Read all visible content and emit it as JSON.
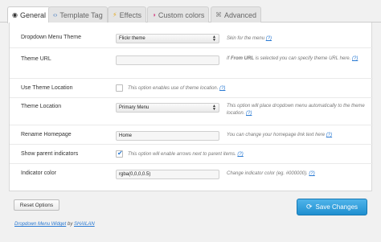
{
  "tabs": [
    {
      "icon": "◉",
      "label": "General"
    },
    {
      "icon": "‹›",
      "label": "Template Tag"
    },
    {
      "icon": "⚡",
      "label": "Effects"
    },
    {
      "icon": "◑",
      "label": "Custom colors"
    },
    {
      "icon": "⌘",
      "label": "Advanced"
    }
  ],
  "rows": {
    "dropdown_theme": {
      "label": "Dropdown Menu Theme",
      "value": "Flickr theme",
      "desc": "Skin for the menu",
      "help": "(?)"
    },
    "theme_url": {
      "label": "Theme URL",
      "value": "",
      "desc_pre": "If ",
      "desc_bold": "From URL",
      "desc_post": " is selected you can specify theme URL here.",
      "help": "(?)"
    },
    "use_location": {
      "label": "Use Theme Location",
      "desc": "This option enables use of theme location.",
      "help": "(?)"
    },
    "theme_location": {
      "label": "Theme Location",
      "value": "Primary Menu",
      "desc": "This option will place dropdown menu automatically to the theme location.",
      "help": "(?)"
    },
    "rename_home": {
      "label": "Rename Homepage",
      "value": "Home",
      "desc": "You can change your homepage link text here",
      "help": "(?)"
    },
    "parent_indicators": {
      "label": "Show parent indicators",
      "desc": "This option will enable arrows next to parent items.",
      "help": "(?)"
    },
    "indicator_color": {
      "label": "Indicator color",
      "value": "rgba(0,0,0,0.5)",
      "desc": "Change indicator color (eg. #000000).",
      "help": "(?)"
    }
  },
  "footer": {
    "reset_label": "Reset Options",
    "save_label": "Save Changes",
    "credit_link": "Dropdown Menu Widget",
    "credit_by": " by ",
    "credit_author": "SHAILAN"
  }
}
